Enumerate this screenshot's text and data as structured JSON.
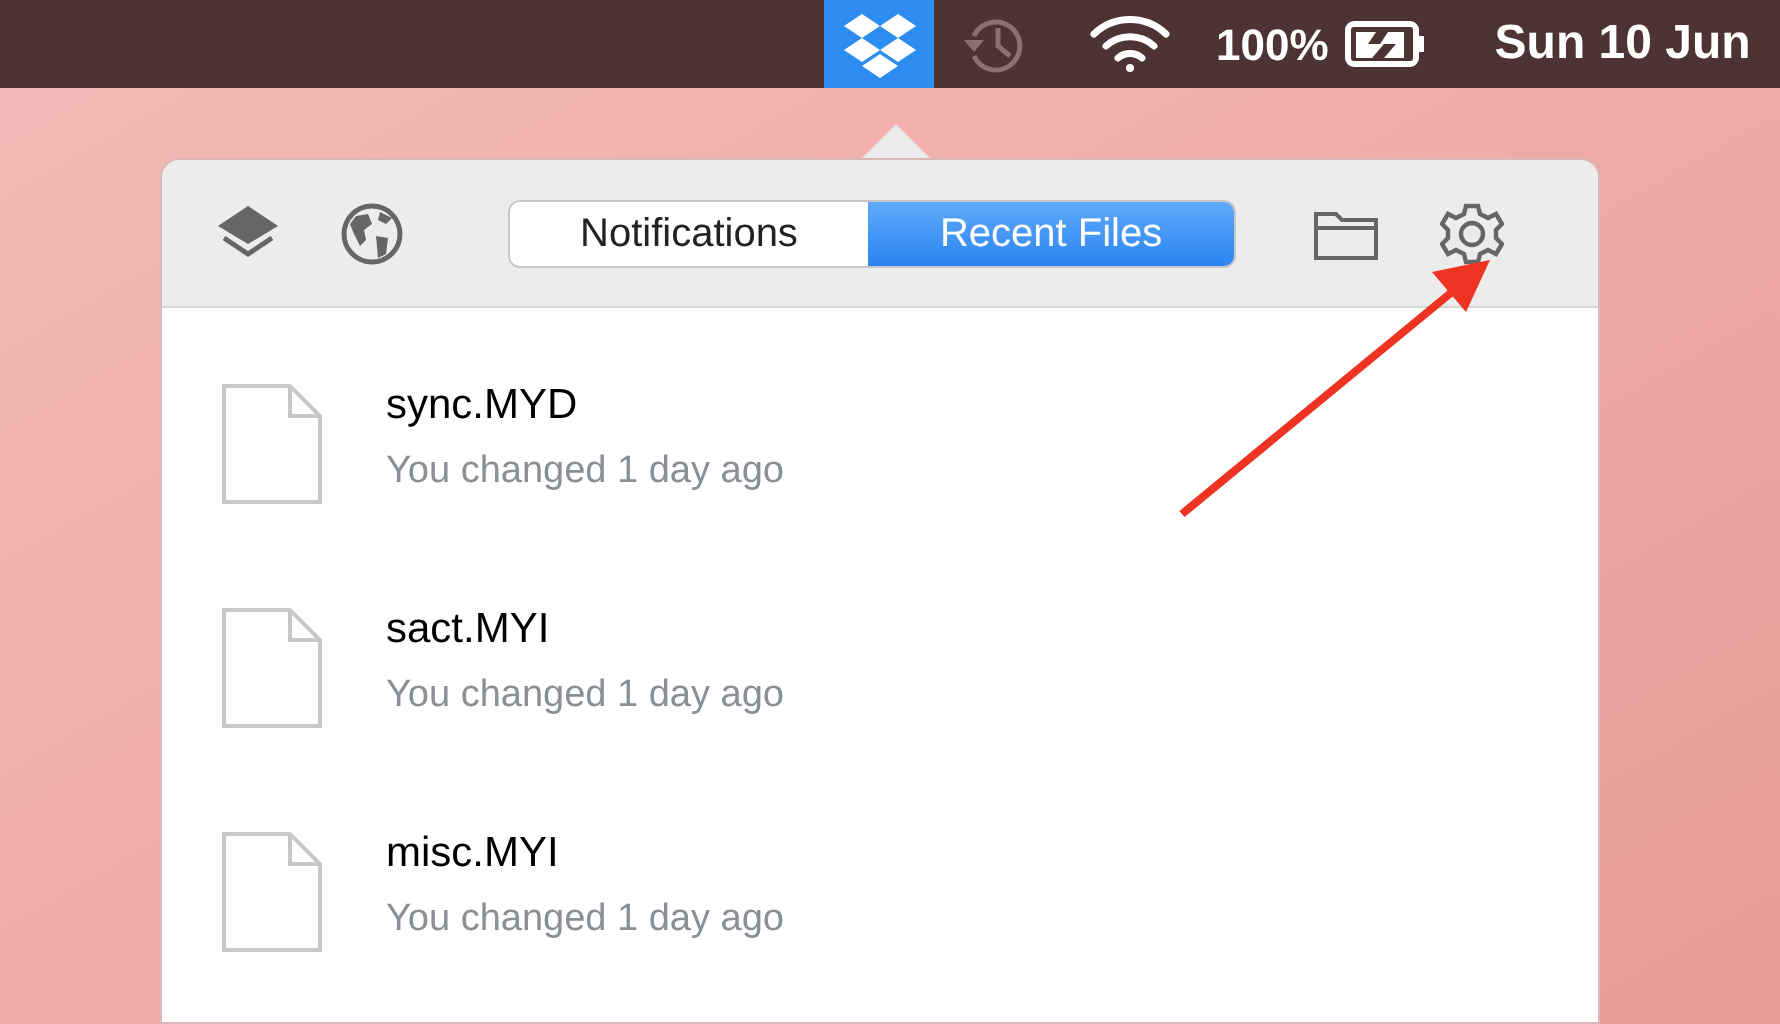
{
  "menu_bar": {
    "dropbox_selected": true,
    "battery_percent": "100%",
    "clock": "Sun 10 Jun"
  },
  "tabs": [
    {
      "label": "Notifications",
      "selected": false
    },
    {
      "label": "Recent Files",
      "selected": true
    }
  ],
  "files": [
    {
      "name": "sync.MYD",
      "detail": "You changed 1 day ago"
    },
    {
      "name": "sact.MYI",
      "detail": "You changed 1 day ago"
    },
    {
      "name": "misc.MYI",
      "detail": "You changed 1 day ago"
    }
  ]
}
